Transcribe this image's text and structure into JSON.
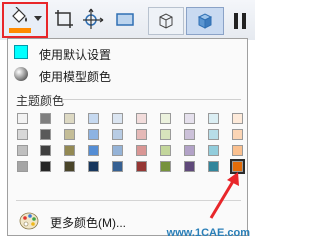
{
  "toolbar": {
    "color_tool_strip_color": "#ff8a00",
    "icons": [
      "paint-bucket-icon",
      "crop-icon",
      "transform-icon",
      "rectangle-icon",
      "wireframe-icon",
      "shaded-icon",
      "pause-icon"
    ]
  },
  "menu": {
    "default_settings": {
      "label": "使用默认设置",
      "color": "#00ffff"
    },
    "model_color": {
      "label": "使用模型颜色"
    },
    "theme_colors_label": "主题颜色",
    "theme_colors": [
      [
        "#f2f2f2",
        "#7f7f7f",
        "#ddd9c3",
        "#c6d9f0",
        "#dbe5f1",
        "#f2dcdb",
        "#ebf1dd",
        "#e5e0ec",
        "#dbeef3",
        "#fdeada"
      ],
      [
        "#d8d8d8",
        "#595959",
        "#c4bd97",
        "#8db3e2",
        "#b8cce4",
        "#e5b9b7",
        "#d7e3bc",
        "#ccc1d9",
        "#b7dde8",
        "#fbd5b5"
      ],
      [
        "#bfbfbf",
        "#3f3f3f",
        "#938953",
        "#548dd4",
        "#95b3d7",
        "#d99694",
        "#c3d69b",
        "#b2a2c7",
        "#92cddc",
        "#fac08f"
      ],
      [
        "#a5a5a5",
        "#262626",
        "#494429",
        "#17365d",
        "#366092",
        "#953734",
        "#76923c",
        "#5f497a",
        "#31859b",
        "#e36c09"
      ]
    ],
    "selected_color": "#e36c09",
    "more_colors": "更多颜色(M)..."
  },
  "watermark": "www.1CAE.com",
  "accent_colors": {
    "highlight_border": "#e8262a",
    "annotation_arrow": "#e8262a"
  }
}
